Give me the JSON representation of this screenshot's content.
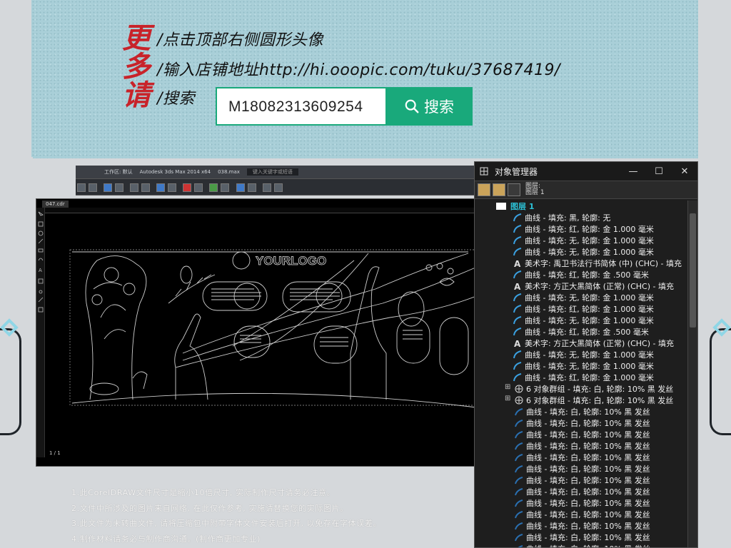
{
  "banner": {
    "vertical_text": "更多请",
    "steps": [
      "/点击顶部右侧圆形头像",
      "/输入店铺地址http://hi.ooopic.com/tuku/37687419/",
      "/搜索"
    ],
    "search_value": "M18082313609254",
    "search_button": "搜索"
  },
  "max_window": {
    "title": "Autodesk 3ds Max  2014 x64",
    "file": "038.max",
    "workspace": "工作区: 默认",
    "search_placeholder": "键入关键字或短语"
  },
  "doc_window": {
    "tab": "047.cdr",
    "logo": "YOURLOGO",
    "page_status": "1 / 1"
  },
  "object_manager": {
    "title": "对象管理器",
    "header_label": "图层:",
    "header_layer": "图层 1",
    "layer_name": "图层 1",
    "rows": [
      {
        "icon": "curve",
        "text": "曲线 - 填充: 黑, 轮廓: 无"
      },
      {
        "icon": "curve",
        "text": "曲线 - 填充: 红, 轮廓: 金  1.000 毫米"
      },
      {
        "icon": "curve",
        "text": "曲线 - 填充: 无, 轮廓: 金  1.000 毫米"
      },
      {
        "icon": "curve",
        "text": "曲线 - 填充: 无, 轮廓: 金  1.000 毫米"
      },
      {
        "icon": "text",
        "text": "美术字: 禹卫书法行书简体 (中) (CHC) - 填充"
      },
      {
        "icon": "curve",
        "text": "曲线 - 填充: 红, 轮廓: 金  .500 毫米"
      },
      {
        "icon": "text",
        "text": "美术字: 方正大黑简体 (正常) (CHC) - 填充"
      },
      {
        "icon": "curve",
        "text": "曲线 - 填充: 无, 轮廓: 金  1.000 毫米"
      },
      {
        "icon": "curve",
        "text": "曲线 - 填充: 红, 轮廓: 金  1.000 毫米"
      },
      {
        "icon": "curve",
        "text": "曲线 - 填充: 无, 轮廓: 金  1.000 毫米"
      },
      {
        "icon": "curve",
        "text": "曲线 - 填充: 红, 轮廓: 金  .500 毫米"
      },
      {
        "icon": "text",
        "text": "美术字: 方正大黑简体 (正常) (CHC) - 填充"
      },
      {
        "icon": "curve",
        "text": "曲线 - 填充: 无, 轮廓: 金  1.000 毫米"
      },
      {
        "icon": "curve",
        "text": "曲线 - 填充: 无, 轮廓: 金  1.000 毫米"
      },
      {
        "icon": "curve",
        "text": "曲线 - 填充: 红, 轮廓: 金  1.000 毫米"
      },
      {
        "icon": "group",
        "text": "6 对象群组 - 填充: 白, 轮廓: 10% 黑  发丝"
      },
      {
        "icon": "group",
        "text": "6 对象群组 - 填充: 白, 轮廓: 10% 黑  发丝"
      },
      {
        "icon": "leaf",
        "text": "曲线 - 填充: 白, 轮廓: 10% 黑  发丝"
      },
      {
        "icon": "leaf",
        "text": "曲线 - 填充: 白, 轮廓: 10% 黑  发丝"
      },
      {
        "icon": "leaf",
        "text": "曲线 - 填充: 白, 轮廓: 10% 黑  发丝"
      },
      {
        "icon": "leaf",
        "text": "曲线 - 填充: 白, 轮廓: 10% 黑  发丝"
      },
      {
        "icon": "leaf",
        "text": "曲线 - 填充: 白, 轮廓: 10% 黑  发丝"
      },
      {
        "icon": "leaf",
        "text": "曲线 - 填充: 白, 轮廓: 10% 黑  发丝"
      },
      {
        "icon": "leaf",
        "text": "曲线 - 填充: 白, 轮廓: 10% 黑  发丝"
      },
      {
        "icon": "leaf",
        "text": "曲线 - 填充: 白, 轮廓: 10% 黑  发丝"
      },
      {
        "icon": "leaf",
        "text": "曲线 - 填充: 白, 轮廓: 10% 黑  发丝"
      },
      {
        "icon": "leaf",
        "text": "曲线 - 填充: 白, 轮廓: 10% 黑  发丝"
      },
      {
        "icon": "leaf",
        "text": "曲线 - 填充: 白, 轮廓: 10% 黑  发丝"
      },
      {
        "icon": "leaf",
        "text": "曲线 - 填充: 白, 轮廓: 10% 黑  发丝"
      },
      {
        "icon": "leaf",
        "text": "曲线 - 填充: 白, 轮廓: 10% 黑  发丝"
      }
    ]
  },
  "notes": [
    "1.此CorelDRAW文件尺寸是缩小10倍尺寸, 实际制作尺寸请务必注意。",
    "2.文件中所涉及的图片来自网络, 在此仅作参考, 实施请替换您的实际图片。",
    "3.此文件为未转曲文件, 请将压缩包中附带字体文件安装后打开, 以免存在字体误差。",
    "4.制作材料请务必与制作商沟通。(制作商更加专业)"
  ],
  "colors": {
    "banner_bg": "#a9cfd8",
    "accent_green": "#19a97b",
    "title_red": "#c8232a",
    "layer_cyan": "#2cc1d6"
  }
}
